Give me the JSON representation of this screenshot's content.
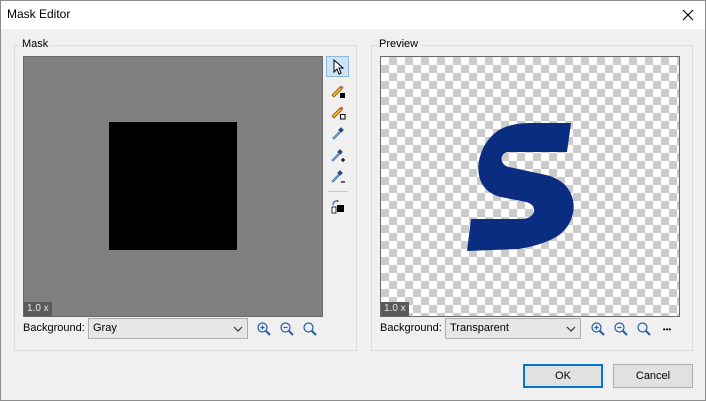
{
  "window": {
    "title": "Mask Editor"
  },
  "mask": {
    "group_label": "Mask",
    "zoom": "1.0 x",
    "background_label": "Background:",
    "background_value": "Gray"
  },
  "preview": {
    "group_label": "Preview",
    "zoom": "1.0 x",
    "background_label": "Background:",
    "background_value": "Transparent",
    "more": "•••"
  },
  "tools": [
    {
      "icon": "pointer-icon",
      "active": true
    },
    {
      "icon": "pencil-fill-icon"
    },
    {
      "icon": "pencil-outline-icon"
    },
    {
      "icon": "eyedropper-icon"
    },
    {
      "icon": "eyedropper-add-icon"
    },
    {
      "icon": "eyedropper-subtract-icon"
    },
    {
      "icon": "invert-mask-icon"
    }
  ],
  "buttons": {
    "ok": "OK",
    "cancel": "Cancel"
  },
  "colors": {
    "accent": "#0078d7",
    "logo_blue": "#0a2d82",
    "mask_bg": "#808080"
  }
}
